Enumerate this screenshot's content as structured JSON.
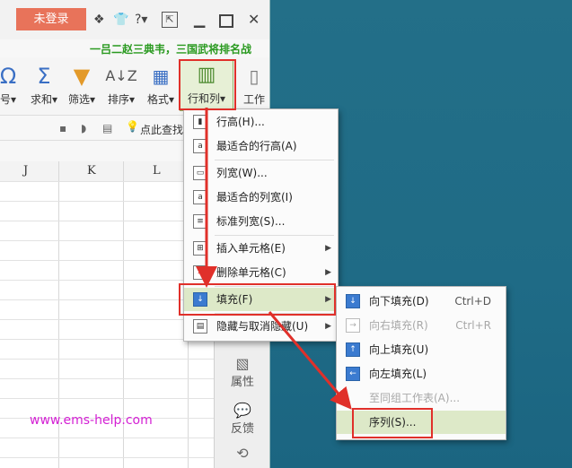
{
  "titlebar": {
    "login_label": "未登录",
    "icons": [
      "shirt-icon",
      "help-icon",
      "new-window-icon",
      "minimize-icon",
      "maximize-icon",
      "close-icon"
    ]
  },
  "promo_text": "一吕二赵三典韦，三国武将排名战",
  "ribbon": {
    "items": [
      {
        "label": "号▾",
        "icon": "omega-icon"
      },
      {
        "label": "求和▾",
        "icon": "sigma-icon"
      },
      {
        "label": "筛选▾",
        "icon": "filter-icon"
      },
      {
        "label": "排序▾",
        "icon": "sort-icon"
      },
      {
        "label": "格式▾",
        "icon": "format-icon"
      },
      {
        "label": "行和列▾",
        "icon": "rowcol-icon"
      },
      {
        "label": "工作",
        "icon": "sheet-icon"
      }
    ]
  },
  "subbar": {
    "find_label": "点此查找"
  },
  "columns": [
    "J",
    "K",
    "L"
  ],
  "sidepanel": {
    "properties": "属性",
    "feedback": "反馈"
  },
  "watermark": "www.ems-help.com",
  "menu_rowcol": {
    "items": [
      {
        "label": "行高(H)..."
      },
      {
        "label": "最适合的行高(A)"
      },
      {
        "label": "列宽(W)..."
      },
      {
        "label": "最适合的列宽(I)"
      },
      {
        "label": "标准列宽(S)..."
      },
      {
        "label": "插入单元格(E)"
      },
      {
        "label": "删除单元格(C)"
      },
      {
        "label": "填充(F)"
      },
      {
        "label": "隐藏与取消隐藏(U)"
      }
    ]
  },
  "menu_fill": {
    "items": [
      {
        "label": "向下填充(D)",
        "shortcut": "Ctrl+D"
      },
      {
        "label": "向右填充(R)",
        "shortcut": "Ctrl+R"
      },
      {
        "label": "向上填充(U)"
      },
      {
        "label": "向左填充(L)"
      },
      {
        "label": "至同组工作表(A)..."
      },
      {
        "label": "序列(S)..."
      }
    ]
  },
  "colors": {
    "desktop": "#1f6f8b",
    "highlight": "#dde9c8",
    "annotation": "#e0302a",
    "login": "#e8735a"
  }
}
